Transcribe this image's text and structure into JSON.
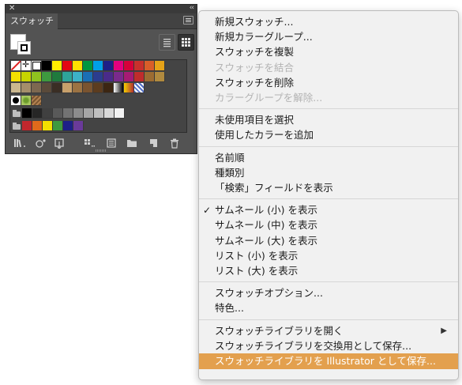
{
  "panel": {
    "tab_label": "スウォッチ",
    "close_glyph": "✕",
    "collapse_glyph": "‹‹",
    "swatch_rows": [
      [
        "none",
        "registration",
        "#ffffff",
        "#000000",
        "#ffed00",
        "#e30613",
        "#ffde00",
        "#009640",
        "#00a0e9",
        "#1d2088",
        "#e4007f",
        "#d7003a",
        "#c9302c",
        "#d95e29",
        "#e6a318"
      ],
      [
        "#f3e000",
        "#c8d400",
        "#8fc31f",
        "#3e9a3f",
        "#1f7a3d",
        "#2ea59a",
        "#3cb2c8",
        "#1a6fb5",
        "#2b3d8f",
        "#4a2b8a",
        "#7a2a8c",
        "#a61b74",
        "#c02c2c",
        "#9c6c32",
        "#b08a3f"
      ],
      [
        "#cbb88f",
        "#a58e6b",
        "#7d6850",
        "#5a4a3a",
        "#3a2e24",
        "#c8a06b",
        "#9c7343",
        "#7a5430",
        "#5c3c1f",
        "#3c2612",
        "grad1",
        "grad2",
        "grad3"
      ],
      [
        "pat1",
        "pat2",
        "pat3"
      ],
      [
        "folder",
        "#000000",
        "#262626",
        "#404040",
        "#595959",
        "#737373",
        "#8c8c8c",
        "#a6a6a6",
        "#bfbfbf",
        "#d9d9d9",
        "#f2f2f2"
      ],
      [
        "folder",
        "#c1272d",
        "#e06a1b",
        "#f3e000",
        "#3e9a3f",
        "#1d2088",
        "#6a3a9a"
      ]
    ],
    "bottom_icons": [
      "swatch-libraries-icon",
      "show-kinds-icon",
      "swatch-options-icon",
      "color-group-icon",
      "edit-color-group-icon",
      "new-color-group-icon",
      "new-swatch-icon",
      "delete-swatch-icon"
    ]
  },
  "menu": {
    "groups": [
      [
        {
          "label": "新規スウォッチ...",
          "enabled": true
        },
        {
          "label": "新規カラーグループ...",
          "enabled": true
        },
        {
          "label": "スウォッチを複製",
          "enabled": true
        },
        {
          "label": "スウォッチを結合",
          "enabled": false
        },
        {
          "label": "スウォッチを削除",
          "enabled": true
        },
        {
          "label": "カラーグループを解除...",
          "enabled": false
        }
      ],
      [
        {
          "label": "未使用項目を選択",
          "enabled": true
        },
        {
          "label": "使用したカラーを追加",
          "enabled": true
        }
      ],
      [
        {
          "label": "名前順",
          "enabled": true
        },
        {
          "label": "種類別",
          "enabled": true
        },
        {
          "label": "「検索」フィールドを表示",
          "enabled": true
        }
      ],
      [
        {
          "label": "サムネール (小) を表示",
          "enabled": true,
          "checked": true
        },
        {
          "label": "サムネール (中) を表示",
          "enabled": true
        },
        {
          "label": "サムネール (大) を表示",
          "enabled": true
        },
        {
          "label": "リスト (小) を表示",
          "enabled": true
        },
        {
          "label": "リスト (大) を表示",
          "enabled": true
        }
      ],
      [
        {
          "label": "スウォッチオプション...",
          "enabled": true
        },
        {
          "label": "特色...",
          "enabled": true
        }
      ],
      [
        {
          "label": "スウォッチライブラリを開く",
          "enabled": true,
          "submenu": true
        },
        {
          "label": "スウォッチライブラリを交換用として保存...",
          "enabled": true
        },
        {
          "label": "スウォッチライブラリを Illustrator として保存...",
          "enabled": true,
          "highlighted": true
        }
      ]
    ],
    "check_glyph": "✓",
    "submenu_glyph": "▶",
    "highlight_color": "#e3a04e"
  }
}
